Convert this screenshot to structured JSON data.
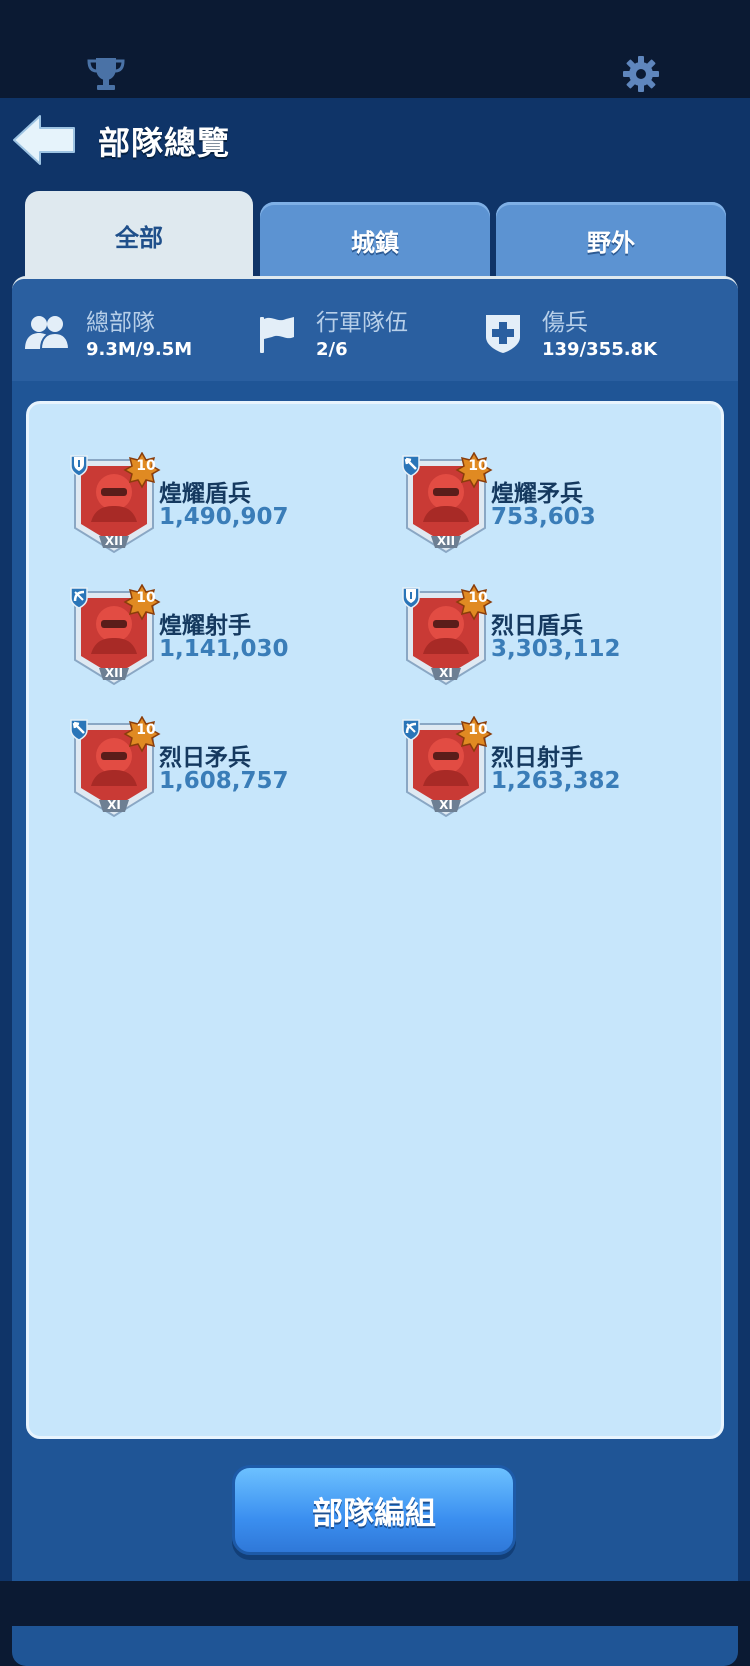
{
  "header": {
    "title": "部隊總覽",
    "icons": [
      "trophy-icon",
      "gear-icon",
      "back-arrow-icon"
    ]
  },
  "tabs": [
    {
      "label": "全部",
      "active": true
    },
    {
      "label": "城鎮",
      "active": false
    },
    {
      "label": "野外",
      "active": false
    }
  ],
  "stats": {
    "total": {
      "label": "總部隊",
      "value": "9.3M/9.5M"
    },
    "march": {
      "label": "行軍隊伍",
      "value": "2/6"
    },
    "wounded": {
      "label": "傷兵",
      "value": "139/355.8K"
    }
  },
  "units": [
    {
      "name": "煌耀盾兵",
      "count": "1,490,907",
      "tier": "XII",
      "level": "10",
      "type": "shield"
    },
    {
      "name": "煌耀矛兵",
      "count": "753,603",
      "tier": "XII",
      "level": "10",
      "type": "spear"
    },
    {
      "name": "煌耀射手",
      "count": "1,141,030",
      "tier": "XII",
      "level": "10",
      "type": "archer"
    },
    {
      "name": "烈日盾兵",
      "count": "3,303,112",
      "tier": "XI",
      "level": "10",
      "type": "shield"
    },
    {
      "name": "烈日矛兵",
      "count": "1,608,757",
      "tier": "XI",
      "level": "10",
      "type": "spear"
    },
    {
      "name": "烈日射手",
      "count": "1,263,382",
      "tier": "XI",
      "level": "10",
      "type": "archer"
    }
  ],
  "action_button": {
    "label": "部隊編組"
  },
  "colors": {
    "background": "#0b1a33",
    "panel": "#1f5596",
    "list_bg": "#c7e6fb",
    "accent_button": "#3b8ff0",
    "unit_name": "#15395f",
    "unit_count": "#3a7db8"
  }
}
